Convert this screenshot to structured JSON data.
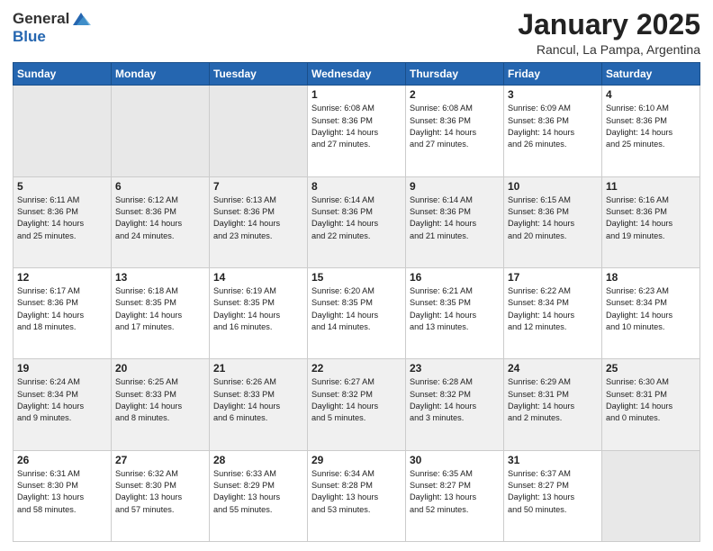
{
  "header": {
    "logo_general": "General",
    "logo_blue": "Blue",
    "title": "January 2025",
    "subtitle": "Rancul, La Pampa, Argentina"
  },
  "weekdays": [
    "Sunday",
    "Monday",
    "Tuesday",
    "Wednesday",
    "Thursday",
    "Friday",
    "Saturday"
  ],
  "weeks": [
    [
      {
        "day": "",
        "info": ""
      },
      {
        "day": "",
        "info": ""
      },
      {
        "day": "",
        "info": ""
      },
      {
        "day": "1",
        "info": "Sunrise: 6:08 AM\nSunset: 8:36 PM\nDaylight: 14 hours\nand 27 minutes."
      },
      {
        "day": "2",
        "info": "Sunrise: 6:08 AM\nSunset: 8:36 PM\nDaylight: 14 hours\nand 27 minutes."
      },
      {
        "day": "3",
        "info": "Sunrise: 6:09 AM\nSunset: 8:36 PM\nDaylight: 14 hours\nand 26 minutes."
      },
      {
        "day": "4",
        "info": "Sunrise: 6:10 AM\nSunset: 8:36 PM\nDaylight: 14 hours\nand 25 minutes."
      }
    ],
    [
      {
        "day": "5",
        "info": "Sunrise: 6:11 AM\nSunset: 8:36 PM\nDaylight: 14 hours\nand 25 minutes."
      },
      {
        "day": "6",
        "info": "Sunrise: 6:12 AM\nSunset: 8:36 PM\nDaylight: 14 hours\nand 24 minutes."
      },
      {
        "day": "7",
        "info": "Sunrise: 6:13 AM\nSunset: 8:36 PM\nDaylight: 14 hours\nand 23 minutes."
      },
      {
        "day": "8",
        "info": "Sunrise: 6:14 AM\nSunset: 8:36 PM\nDaylight: 14 hours\nand 22 minutes."
      },
      {
        "day": "9",
        "info": "Sunrise: 6:14 AM\nSunset: 8:36 PM\nDaylight: 14 hours\nand 21 minutes."
      },
      {
        "day": "10",
        "info": "Sunrise: 6:15 AM\nSunset: 8:36 PM\nDaylight: 14 hours\nand 20 minutes."
      },
      {
        "day": "11",
        "info": "Sunrise: 6:16 AM\nSunset: 8:36 PM\nDaylight: 14 hours\nand 19 minutes."
      }
    ],
    [
      {
        "day": "12",
        "info": "Sunrise: 6:17 AM\nSunset: 8:36 PM\nDaylight: 14 hours\nand 18 minutes."
      },
      {
        "day": "13",
        "info": "Sunrise: 6:18 AM\nSunset: 8:35 PM\nDaylight: 14 hours\nand 17 minutes."
      },
      {
        "day": "14",
        "info": "Sunrise: 6:19 AM\nSunset: 8:35 PM\nDaylight: 14 hours\nand 16 minutes."
      },
      {
        "day": "15",
        "info": "Sunrise: 6:20 AM\nSunset: 8:35 PM\nDaylight: 14 hours\nand 14 minutes."
      },
      {
        "day": "16",
        "info": "Sunrise: 6:21 AM\nSunset: 8:35 PM\nDaylight: 14 hours\nand 13 minutes."
      },
      {
        "day": "17",
        "info": "Sunrise: 6:22 AM\nSunset: 8:34 PM\nDaylight: 14 hours\nand 12 minutes."
      },
      {
        "day": "18",
        "info": "Sunrise: 6:23 AM\nSunset: 8:34 PM\nDaylight: 14 hours\nand 10 minutes."
      }
    ],
    [
      {
        "day": "19",
        "info": "Sunrise: 6:24 AM\nSunset: 8:34 PM\nDaylight: 14 hours\nand 9 minutes."
      },
      {
        "day": "20",
        "info": "Sunrise: 6:25 AM\nSunset: 8:33 PM\nDaylight: 14 hours\nand 8 minutes."
      },
      {
        "day": "21",
        "info": "Sunrise: 6:26 AM\nSunset: 8:33 PM\nDaylight: 14 hours\nand 6 minutes."
      },
      {
        "day": "22",
        "info": "Sunrise: 6:27 AM\nSunset: 8:32 PM\nDaylight: 14 hours\nand 5 minutes."
      },
      {
        "day": "23",
        "info": "Sunrise: 6:28 AM\nSunset: 8:32 PM\nDaylight: 14 hours\nand 3 minutes."
      },
      {
        "day": "24",
        "info": "Sunrise: 6:29 AM\nSunset: 8:31 PM\nDaylight: 14 hours\nand 2 minutes."
      },
      {
        "day": "25",
        "info": "Sunrise: 6:30 AM\nSunset: 8:31 PM\nDaylight: 14 hours\nand 0 minutes."
      }
    ],
    [
      {
        "day": "26",
        "info": "Sunrise: 6:31 AM\nSunset: 8:30 PM\nDaylight: 13 hours\nand 58 minutes."
      },
      {
        "day": "27",
        "info": "Sunrise: 6:32 AM\nSunset: 8:30 PM\nDaylight: 13 hours\nand 57 minutes."
      },
      {
        "day": "28",
        "info": "Sunrise: 6:33 AM\nSunset: 8:29 PM\nDaylight: 13 hours\nand 55 minutes."
      },
      {
        "day": "29",
        "info": "Sunrise: 6:34 AM\nSunset: 8:28 PM\nDaylight: 13 hours\nand 53 minutes."
      },
      {
        "day": "30",
        "info": "Sunrise: 6:35 AM\nSunset: 8:27 PM\nDaylight: 13 hours\nand 52 minutes."
      },
      {
        "day": "31",
        "info": "Sunrise: 6:37 AM\nSunset: 8:27 PM\nDaylight: 13 hours\nand 50 minutes."
      },
      {
        "day": "",
        "info": ""
      }
    ]
  ]
}
